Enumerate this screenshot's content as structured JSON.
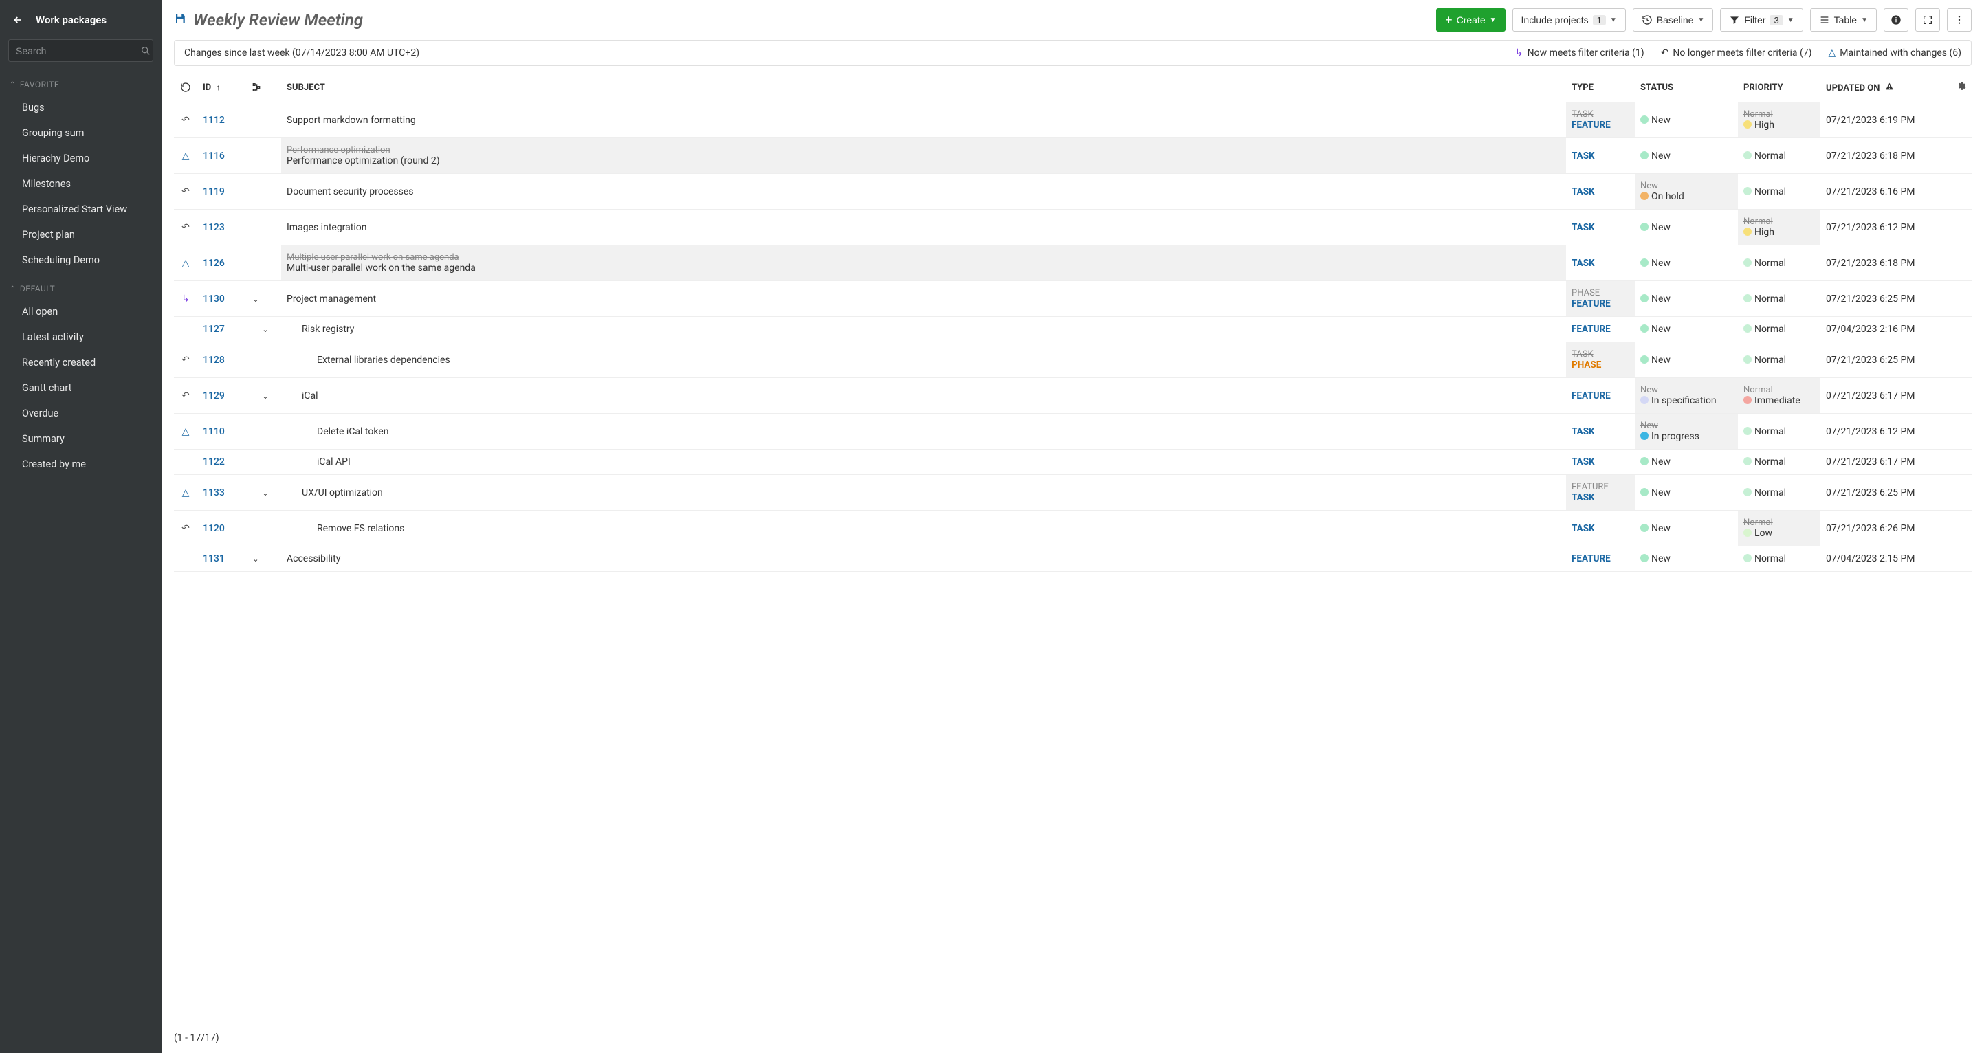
{
  "sidebar": {
    "title": "Work packages",
    "search_placeholder": "Search",
    "sections": [
      {
        "heading": "FAVORITE",
        "items": [
          "Bugs",
          "Grouping sum",
          "Hierachy Demo",
          "Milestones",
          "Personalized Start View",
          "Project plan",
          "Scheduling Demo"
        ]
      },
      {
        "heading": "DEFAULT",
        "items": [
          "All open",
          "Latest activity",
          "Recently created",
          "Gantt chart",
          "Overdue",
          "Summary",
          "Created by me"
        ]
      }
    ]
  },
  "header": {
    "page_title": "Weekly Review Meeting",
    "create_label": "Create",
    "include_label": "Include projects",
    "include_count": "1",
    "baseline_label": "Baseline",
    "filter_label": "Filter",
    "filter_count": "3",
    "view_label": "Table"
  },
  "baseline_band": {
    "text": "Changes since last week (07/14/2023 8:00 AM UTC+2)",
    "legend_meets": "Now meets filter criteria (1)",
    "legend_nolonger": "No longer meets filter criteria (7)",
    "legend_maintained": "Maintained with changes (6)"
  },
  "columns": {
    "id": "ID",
    "subject": "SUBJECT",
    "type": "TYPE",
    "status": "STATUS",
    "priority": "PRIORITY",
    "updated": "UPDATED ON"
  },
  "rows": [
    {
      "delta": "undo",
      "id": "1112",
      "indent": 0,
      "tree": "",
      "subject_old": "",
      "subject": "Support markdown formatting",
      "type_old": "TASK",
      "type": "FEATURE",
      "type_cls": "feature",
      "status_old": "",
      "status": "New",
      "status_dot": "new",
      "priority_old": "Normal",
      "priority": "High",
      "priority_dot": "high",
      "updated": "07/21/2023 6:19 PM"
    },
    {
      "delta": "triangle",
      "id": "1116",
      "indent": 0,
      "tree": "",
      "subject_old": "Performance optimization",
      "subject": "Performance optimization (round 2)",
      "type_old": "",
      "type": "TASK",
      "type_cls": "task",
      "status_old": "",
      "status": "New",
      "status_dot": "new",
      "priority_old": "",
      "priority": "Normal",
      "priority_dot": "normal",
      "updated": "07/21/2023 6:18 PM"
    },
    {
      "delta": "undo",
      "id": "1119",
      "indent": 0,
      "tree": "",
      "subject_old": "",
      "subject": "Document security processes",
      "type_old": "",
      "type": "TASK",
      "type_cls": "task",
      "status_old": "New",
      "status": "On hold",
      "status_dot": "hold",
      "priority_old": "",
      "priority": "Normal",
      "priority_dot": "normal",
      "updated": "07/21/2023 6:16 PM"
    },
    {
      "delta": "undo",
      "id": "1123",
      "indent": 0,
      "tree": "",
      "subject_old": "",
      "subject": "Images integration",
      "type_old": "",
      "type": "TASK",
      "type_cls": "task",
      "status_old": "",
      "status": "New",
      "status_dot": "new",
      "priority_old": "Normal",
      "priority": "High",
      "priority_dot": "high",
      "updated": "07/21/2023 6:12 PM"
    },
    {
      "delta": "triangle",
      "id": "1126",
      "indent": 0,
      "tree": "",
      "subject_old": "Multiple user parallel work on same agenda",
      "subject": "Multi-user parallel work on the same agenda",
      "type_old": "",
      "type": "TASK",
      "type_cls": "task",
      "status_old": "",
      "status": "New",
      "status_dot": "new",
      "priority_old": "",
      "priority": "Normal",
      "priority_dot": "normal",
      "updated": "07/21/2023 6:18 PM"
    },
    {
      "delta": "enter",
      "id": "1130",
      "indent": 0,
      "tree": "down",
      "subject_old": "",
      "subject": "Project management",
      "type_old": "PHASE",
      "type": "FEATURE",
      "type_cls": "feature",
      "status_old": "",
      "status": "New",
      "status_dot": "new",
      "priority_old": "",
      "priority": "Normal",
      "priority_dot": "normal",
      "updated": "07/21/2023 6:25 PM"
    },
    {
      "delta": "",
      "id": "1127",
      "indent": 1,
      "tree": "down",
      "subject_old": "",
      "subject": "Risk registry",
      "type_old": "",
      "type": "FEATURE",
      "type_cls": "feature",
      "status_old": "",
      "status": "New",
      "status_dot": "new",
      "priority_old": "",
      "priority": "Normal",
      "priority_dot": "normal",
      "updated": "07/04/2023 2:16 PM"
    },
    {
      "delta": "undo",
      "id": "1128",
      "indent": 2,
      "tree": "",
      "subject_old": "",
      "subject": "External libraries dependencies",
      "type_old": "TASK",
      "type": "PHASE",
      "type_cls": "phase",
      "status_old": "",
      "status": "New",
      "status_dot": "new",
      "priority_old": "",
      "priority": "Normal",
      "priority_dot": "normal",
      "updated": "07/21/2023 6:25 PM"
    },
    {
      "delta": "undo",
      "id": "1129",
      "indent": 1,
      "tree": "down",
      "subject_old": "",
      "subject": "iCal",
      "type_old": "",
      "type": "FEATURE",
      "type_cls": "feature",
      "status_old": "New",
      "status": "In specification",
      "status_dot": "spec",
      "priority_old": "Normal",
      "priority": "Immediate",
      "priority_dot": "immediate",
      "updated": "07/21/2023 6:17 PM"
    },
    {
      "delta": "triangle",
      "id": "1110",
      "indent": 2,
      "tree": "",
      "subject_old": "",
      "subject": "Delete iCal token",
      "type_old": "",
      "type": "TASK",
      "type_cls": "task",
      "status_old": "New",
      "status": "In progress",
      "status_dot": "prog",
      "priority_old": "",
      "priority": "Normal",
      "priority_dot": "normal",
      "updated": "07/21/2023 6:12 PM"
    },
    {
      "delta": "",
      "id": "1122",
      "indent": 2,
      "tree": "",
      "subject_old": "",
      "subject": "iCal API",
      "type_old": "",
      "type": "TASK",
      "type_cls": "task",
      "status_old": "",
      "status": "New",
      "status_dot": "new",
      "priority_old": "",
      "priority": "Normal",
      "priority_dot": "normal",
      "updated": "07/21/2023 6:17 PM"
    },
    {
      "delta": "triangle",
      "id": "1133",
      "indent": 1,
      "tree": "down",
      "subject_old": "",
      "subject": "UX/UI optimization",
      "type_old": "FEATURE",
      "type": "TASK",
      "type_cls": "task",
      "status_old": "",
      "status": "New",
      "status_dot": "new",
      "priority_old": "",
      "priority": "Normal",
      "priority_dot": "normal",
      "updated": "07/21/2023 6:25 PM"
    },
    {
      "delta": "undo",
      "id": "1120",
      "indent": 2,
      "tree": "",
      "subject_old": "",
      "subject": "Remove FS relations",
      "type_old": "",
      "type": "TASK",
      "type_cls": "task",
      "status_old": "",
      "status": "New",
      "status_dot": "new",
      "priority_old": "Normal",
      "priority": "Low",
      "priority_dot": "low",
      "updated": "07/21/2023 6:26 PM"
    },
    {
      "delta": "",
      "id": "1131",
      "indent": 0,
      "tree": "down",
      "subject_old": "",
      "subject": "Accessibility",
      "type_old": "",
      "type": "FEATURE",
      "type_cls": "feature",
      "status_old": "",
      "status": "New",
      "status_dot": "new",
      "priority_old": "",
      "priority": "Normal",
      "priority_dot": "normal",
      "updated": "07/04/2023 2:15 PM"
    }
  ],
  "footer": "(1 - 17/17)"
}
